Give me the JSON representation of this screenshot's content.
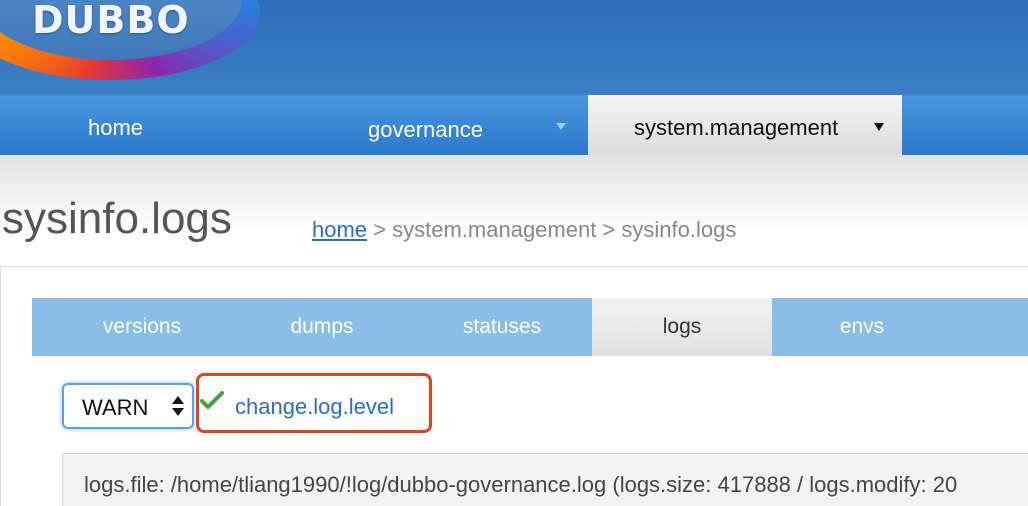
{
  "header": {
    "logo_text": "DUBBO"
  },
  "nav": {
    "items": [
      {
        "label": "home"
      },
      {
        "label": "governance"
      },
      {
        "label": "system.management"
      }
    ]
  },
  "page": {
    "title": "sysinfo.logs",
    "breadcrumb": {
      "home": "home",
      "rest": " > system.management > sysinfo.logs"
    }
  },
  "tabs": [
    {
      "label": "versions"
    },
    {
      "label": "dumps"
    },
    {
      "label": "statuses"
    },
    {
      "label": "logs",
      "active": true
    },
    {
      "label": "envs"
    }
  ],
  "log_level": {
    "selected": "WARN",
    "action_label": "change.log.level"
  },
  "info": {
    "text": "logs.file: /home/tliang1990/!log/dubbo-governance.log (logs.size: 417888 / logs.modify: 20"
  },
  "colors": {
    "header": "#2c6fb6",
    "nav": "#3a88d8",
    "tabs": "#8bbde9",
    "link": "#2a6ec4",
    "highlight": "#e2421d"
  }
}
